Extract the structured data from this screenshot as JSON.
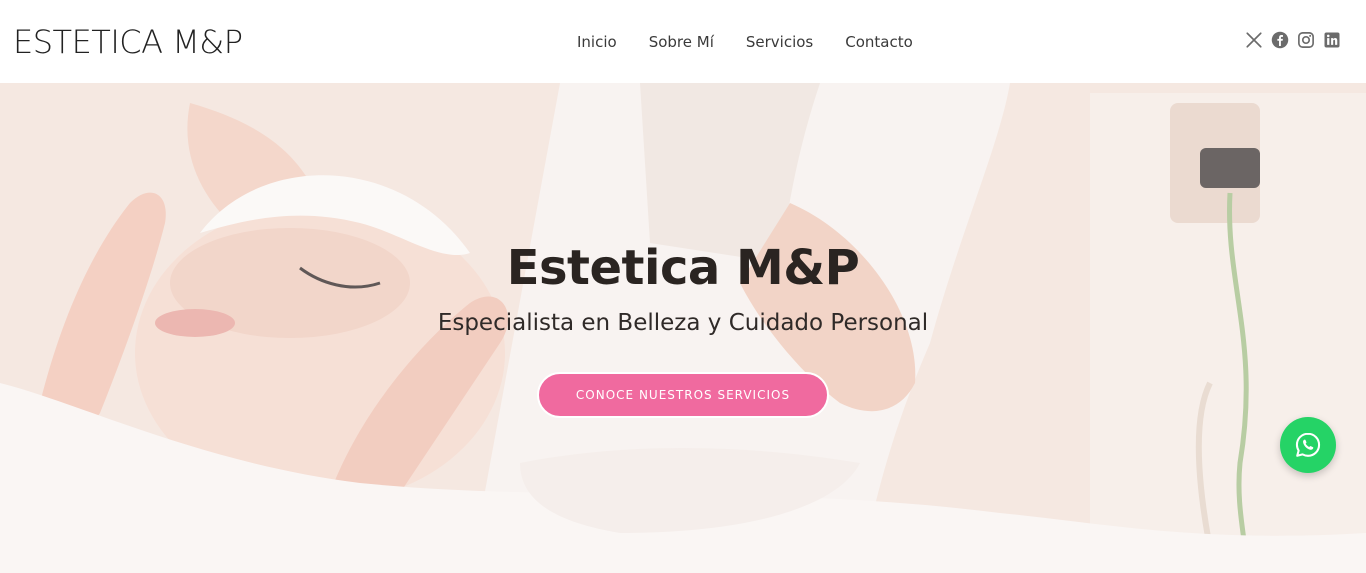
{
  "header": {
    "brand": "ESTETICA M&P",
    "nav": [
      {
        "label": "Inicio"
      },
      {
        "label": "Sobre Mí"
      },
      {
        "label": "Servicios"
      },
      {
        "label": "Contacto"
      }
    ],
    "social": [
      "x-icon",
      "facebook-icon",
      "instagram-icon",
      "linkedin-icon"
    ]
  },
  "hero": {
    "title": "Estetica M&P",
    "subtitle": "Especialista en Belleza y Cuidado Personal",
    "cta_label": "CONOCE NUESTROS SERVICIOS",
    "image": "facial-treatment-photo"
  },
  "floating": {
    "icon": "whatsapp-icon"
  },
  "colors": {
    "accent": "#f06a9f",
    "whatsapp": "#25d366",
    "text": "#222222"
  }
}
